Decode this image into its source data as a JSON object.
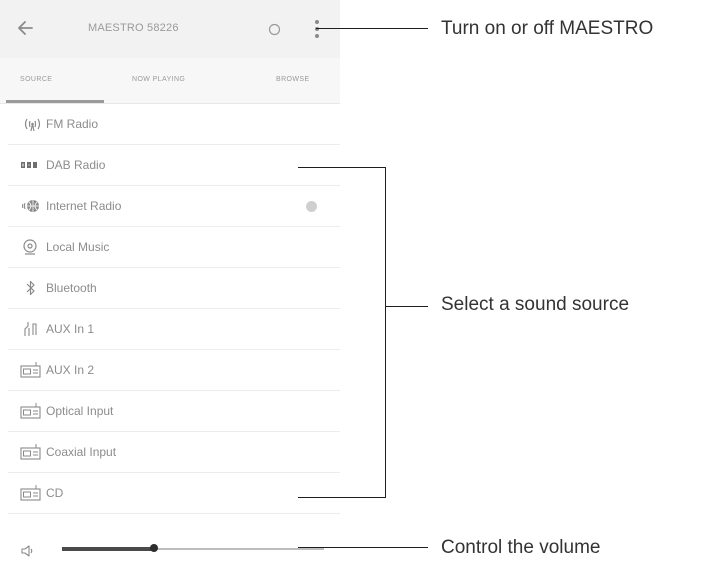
{
  "app": {
    "device_name": "MAESTRO 58226",
    "tabs": [
      "SOURCE",
      "NOW PLAYING",
      "BROWSE"
    ],
    "active_tab_index": 0
  },
  "sources": [
    {
      "label": "FM Radio",
      "icon": "fm-radio-icon"
    },
    {
      "label": "DAB Radio",
      "icon": "dab-radio-icon"
    },
    {
      "label": "Internet Radio",
      "icon": "internet-radio-icon",
      "has_status_dot": true
    },
    {
      "label": "Local Music",
      "icon": "local-music-icon"
    },
    {
      "label": "Bluetooth",
      "icon": "bluetooth-icon"
    },
    {
      "label": "AUX In 1",
      "icon": "aux-in-icon"
    },
    {
      "label": "AUX In 2",
      "icon": "input-device-icon"
    },
    {
      "label": "Optical Input",
      "icon": "input-device-icon"
    },
    {
      "label": "Coaxial Input",
      "icon": "input-device-icon"
    },
    {
      "label": "CD",
      "icon": "input-device-icon"
    }
  ],
  "volume": {
    "level": 0.35
  },
  "annotations": {
    "power": "Turn on or off MAESTRO",
    "source": "Select a sound source",
    "volume": "Control the volume"
  },
  "colors": {
    "header_bg": "#f2f2f2",
    "text_muted": "#8c8c8c",
    "annotation_text": "#333333",
    "line": "#1e1e1e"
  }
}
